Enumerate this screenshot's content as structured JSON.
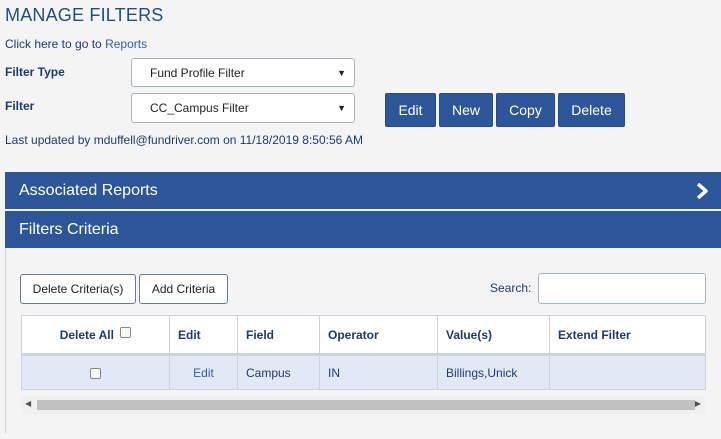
{
  "page": {
    "title": "MANAGE FILTERS"
  },
  "reports_link": {
    "prefix": "Click here to go to ",
    "link_text": "Reports"
  },
  "filter_type": {
    "label": "Filter Type",
    "selected": "Fund Profile Filter"
  },
  "filter": {
    "label": "Filter",
    "selected": "CC_Campus Filter"
  },
  "actions": {
    "edit": "Edit",
    "new": "New",
    "copy": "Copy",
    "delete": "Delete"
  },
  "last_updated": "Last updated by mduffell@fundriver.com on 11/18/2019 8:50:56 AM",
  "panels": {
    "associated_reports": "Associated Reports",
    "filters_criteria": "Filters Criteria"
  },
  "criteria_toolbar": {
    "delete_criteria": "Delete Criteria(s)",
    "add_criteria": "Add Criteria",
    "search_label": "Search:",
    "search_value": ""
  },
  "table": {
    "headers": [
      "Delete All",
      "Edit",
      "Field",
      "Operator",
      "Value(s)",
      "Extend Filter"
    ],
    "rows": [
      {
        "edit": "Edit",
        "field": "Campus",
        "operator": "IN",
        "values": "Billings,Unick",
        "extend": ""
      }
    ]
  },
  "colors": {
    "accent": "#2d5599",
    "row_bg": "#e2e9f6",
    "page_bg": "#f4f4f4"
  },
  "icons": {
    "panel_chevron": "chevron-right-icon",
    "dropdown": "caret-down-icon"
  }
}
